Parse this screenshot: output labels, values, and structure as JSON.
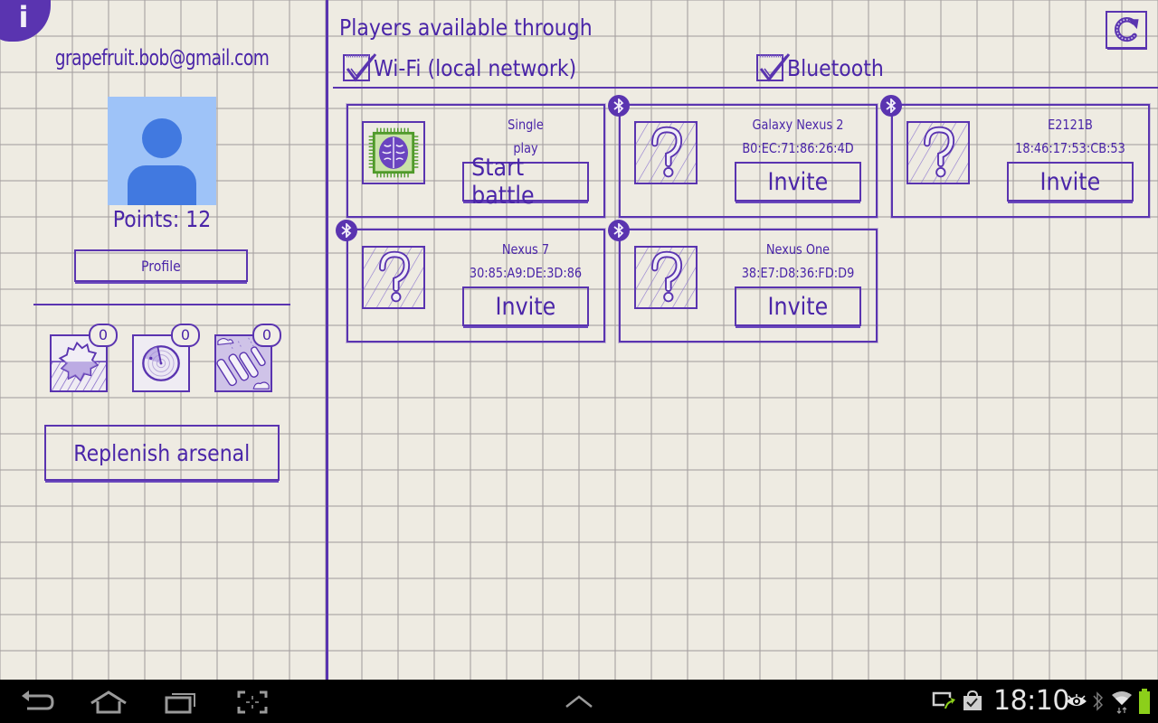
{
  "sidebar": {
    "info_icon_glyph": "i",
    "email": "grapefruit.bob@gmail.com",
    "points_label": "Points: 12",
    "points_value": 12,
    "profile_button": "Profile",
    "arsenal": [
      {
        "name": "mine",
        "icon": "gear-splash-icon",
        "count": "0"
      },
      {
        "name": "radar",
        "icon": "radar-icon",
        "count": "0"
      },
      {
        "name": "missiles",
        "icon": "missile-barrage-icon",
        "count": "0"
      }
    ],
    "replenish_button": "Replenish arsenal"
  },
  "main": {
    "title": "Players available through",
    "filters": [
      {
        "label": "Wi-Fi (local network)",
        "checked": true
      },
      {
        "label": "Bluetooth",
        "checked": true
      }
    ],
    "refresh_icon": "refresh-icon",
    "players": [
      {
        "name_line1": "Single",
        "name_line2": "play",
        "button": "Start battle",
        "icon": "brain-chip-icon",
        "bluetooth": false
      },
      {
        "name_line1": "Galaxy Nexus 2",
        "name_line2": "B0:EC:71:86:26:4D",
        "button": "Invite",
        "icon": "unknown-player-icon",
        "bluetooth": true
      },
      {
        "name_line1": "E2121B",
        "name_line2": "18:46:17:53:CB:53",
        "button": "Invite",
        "icon": "unknown-player-icon",
        "bluetooth": true
      },
      {
        "name_line1": "Nexus 7",
        "name_line2": "30:85:A9:DE:3D:86",
        "button": "Invite",
        "icon": "unknown-player-icon",
        "bluetooth": true
      },
      {
        "name_line1": "Nexus One",
        "name_line2": "38:E7:D8:36:FD:D9",
        "button": "Invite",
        "icon": "unknown-player-icon",
        "bluetooth": true
      }
    ]
  },
  "system_bar": {
    "time": "18:10",
    "accent_ink": "#5a34b0",
    "battery_color": "#8ccf1a"
  }
}
